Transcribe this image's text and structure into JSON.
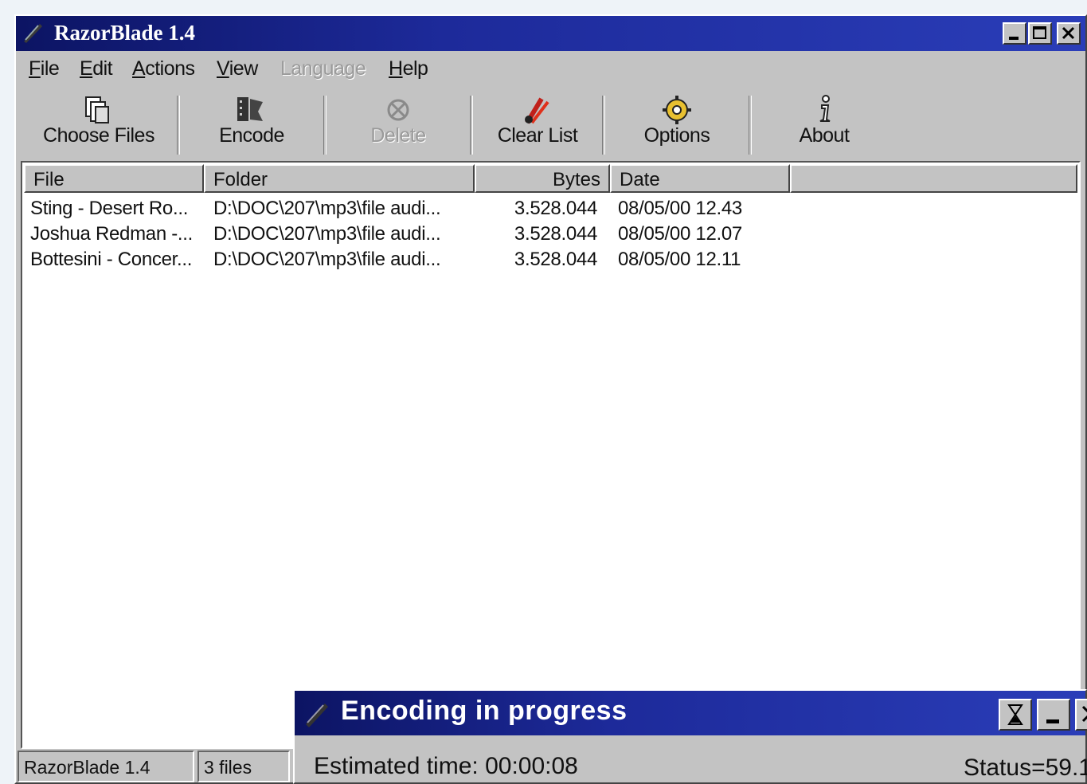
{
  "window": {
    "title": "RazorBlade 1.4"
  },
  "menu": {
    "items": [
      {
        "label": "File",
        "mnemonic": "F",
        "rest": "ile"
      },
      {
        "label": "Edit",
        "mnemonic": "E",
        "rest": "dit"
      },
      {
        "label": "Actions",
        "mnemonic": "A",
        "rest": "ctions"
      },
      {
        "label": "View",
        "mnemonic": "V",
        "rest": "iew"
      },
      {
        "label": "Language",
        "mnemonic": "",
        "rest": "Language"
      },
      {
        "label": "Help",
        "mnemonic": "H",
        "rest": "elp"
      }
    ]
  },
  "toolbar": {
    "choose_files": "Choose Files",
    "encode": "Encode",
    "delete": "Delete",
    "clear_list": "Clear List",
    "options": "Options",
    "about": "About"
  },
  "list": {
    "columns": [
      "File",
      "Folder",
      "Bytes",
      "Date",
      ""
    ],
    "rows": [
      {
        "file": "Sting - Desert Ro...",
        "folder": "D:\\DOC\\207\\mp3\\file audi...",
        "bytes": "3.528.044",
        "date": "08/05/00 12.43"
      },
      {
        "file": "Joshua Redman -...",
        "folder": "D:\\DOC\\207\\mp3\\file audi...",
        "bytes": "3.528.044",
        "date": "08/05/00 12.07"
      },
      {
        "file": "Bottesini - Concer...",
        "folder": "D:\\DOC\\207\\mp3\\file audi...",
        "bytes": "3.528.044",
        "date": "08/05/00 12.11"
      }
    ]
  },
  "statusbar": {
    "app": "RazorBlade 1.4",
    "files": "3 files"
  },
  "dialog": {
    "title": "Encoding in progress",
    "estimated_time": "Estimated time: 00:00:08",
    "status": "Status=59.1"
  },
  "colors": {
    "title_gradient_start": "#0c1463",
    "title_gradient_end": "#2a3db8",
    "face": "#c3c3c3"
  }
}
